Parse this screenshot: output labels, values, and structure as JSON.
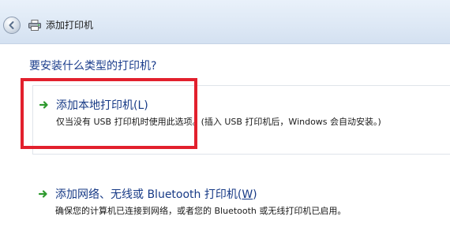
{
  "window": {
    "title": "添加打印机"
  },
  "page": {
    "heading": "要安装什么类型的打印机?"
  },
  "options": [
    {
      "title": "添加本地打印机(L)",
      "description": "仅当没有 USB 打印机时使用此选项。(插入 USB 打印机后，Windows 会自动安装。)"
    },
    {
      "title_prefix": "添加网络、无线或 Bluetooth 打印机(",
      "title_key": "W",
      "title_suffix": ")",
      "description": "确保您的计算机已连接到网络，或者您的 Bluetooth 或无线打印机已启用。"
    }
  ],
  "icons": {
    "back": "back-arrow-icon",
    "printer": "printer-icon",
    "option_arrow": "green-arrow-icon"
  },
  "colors": {
    "heading": "#1b3d8c",
    "option_title": "#173a86",
    "arrow_green": "#2e9a2e",
    "highlight_red": "#e2202d",
    "titlebar": "#dde8f5"
  }
}
